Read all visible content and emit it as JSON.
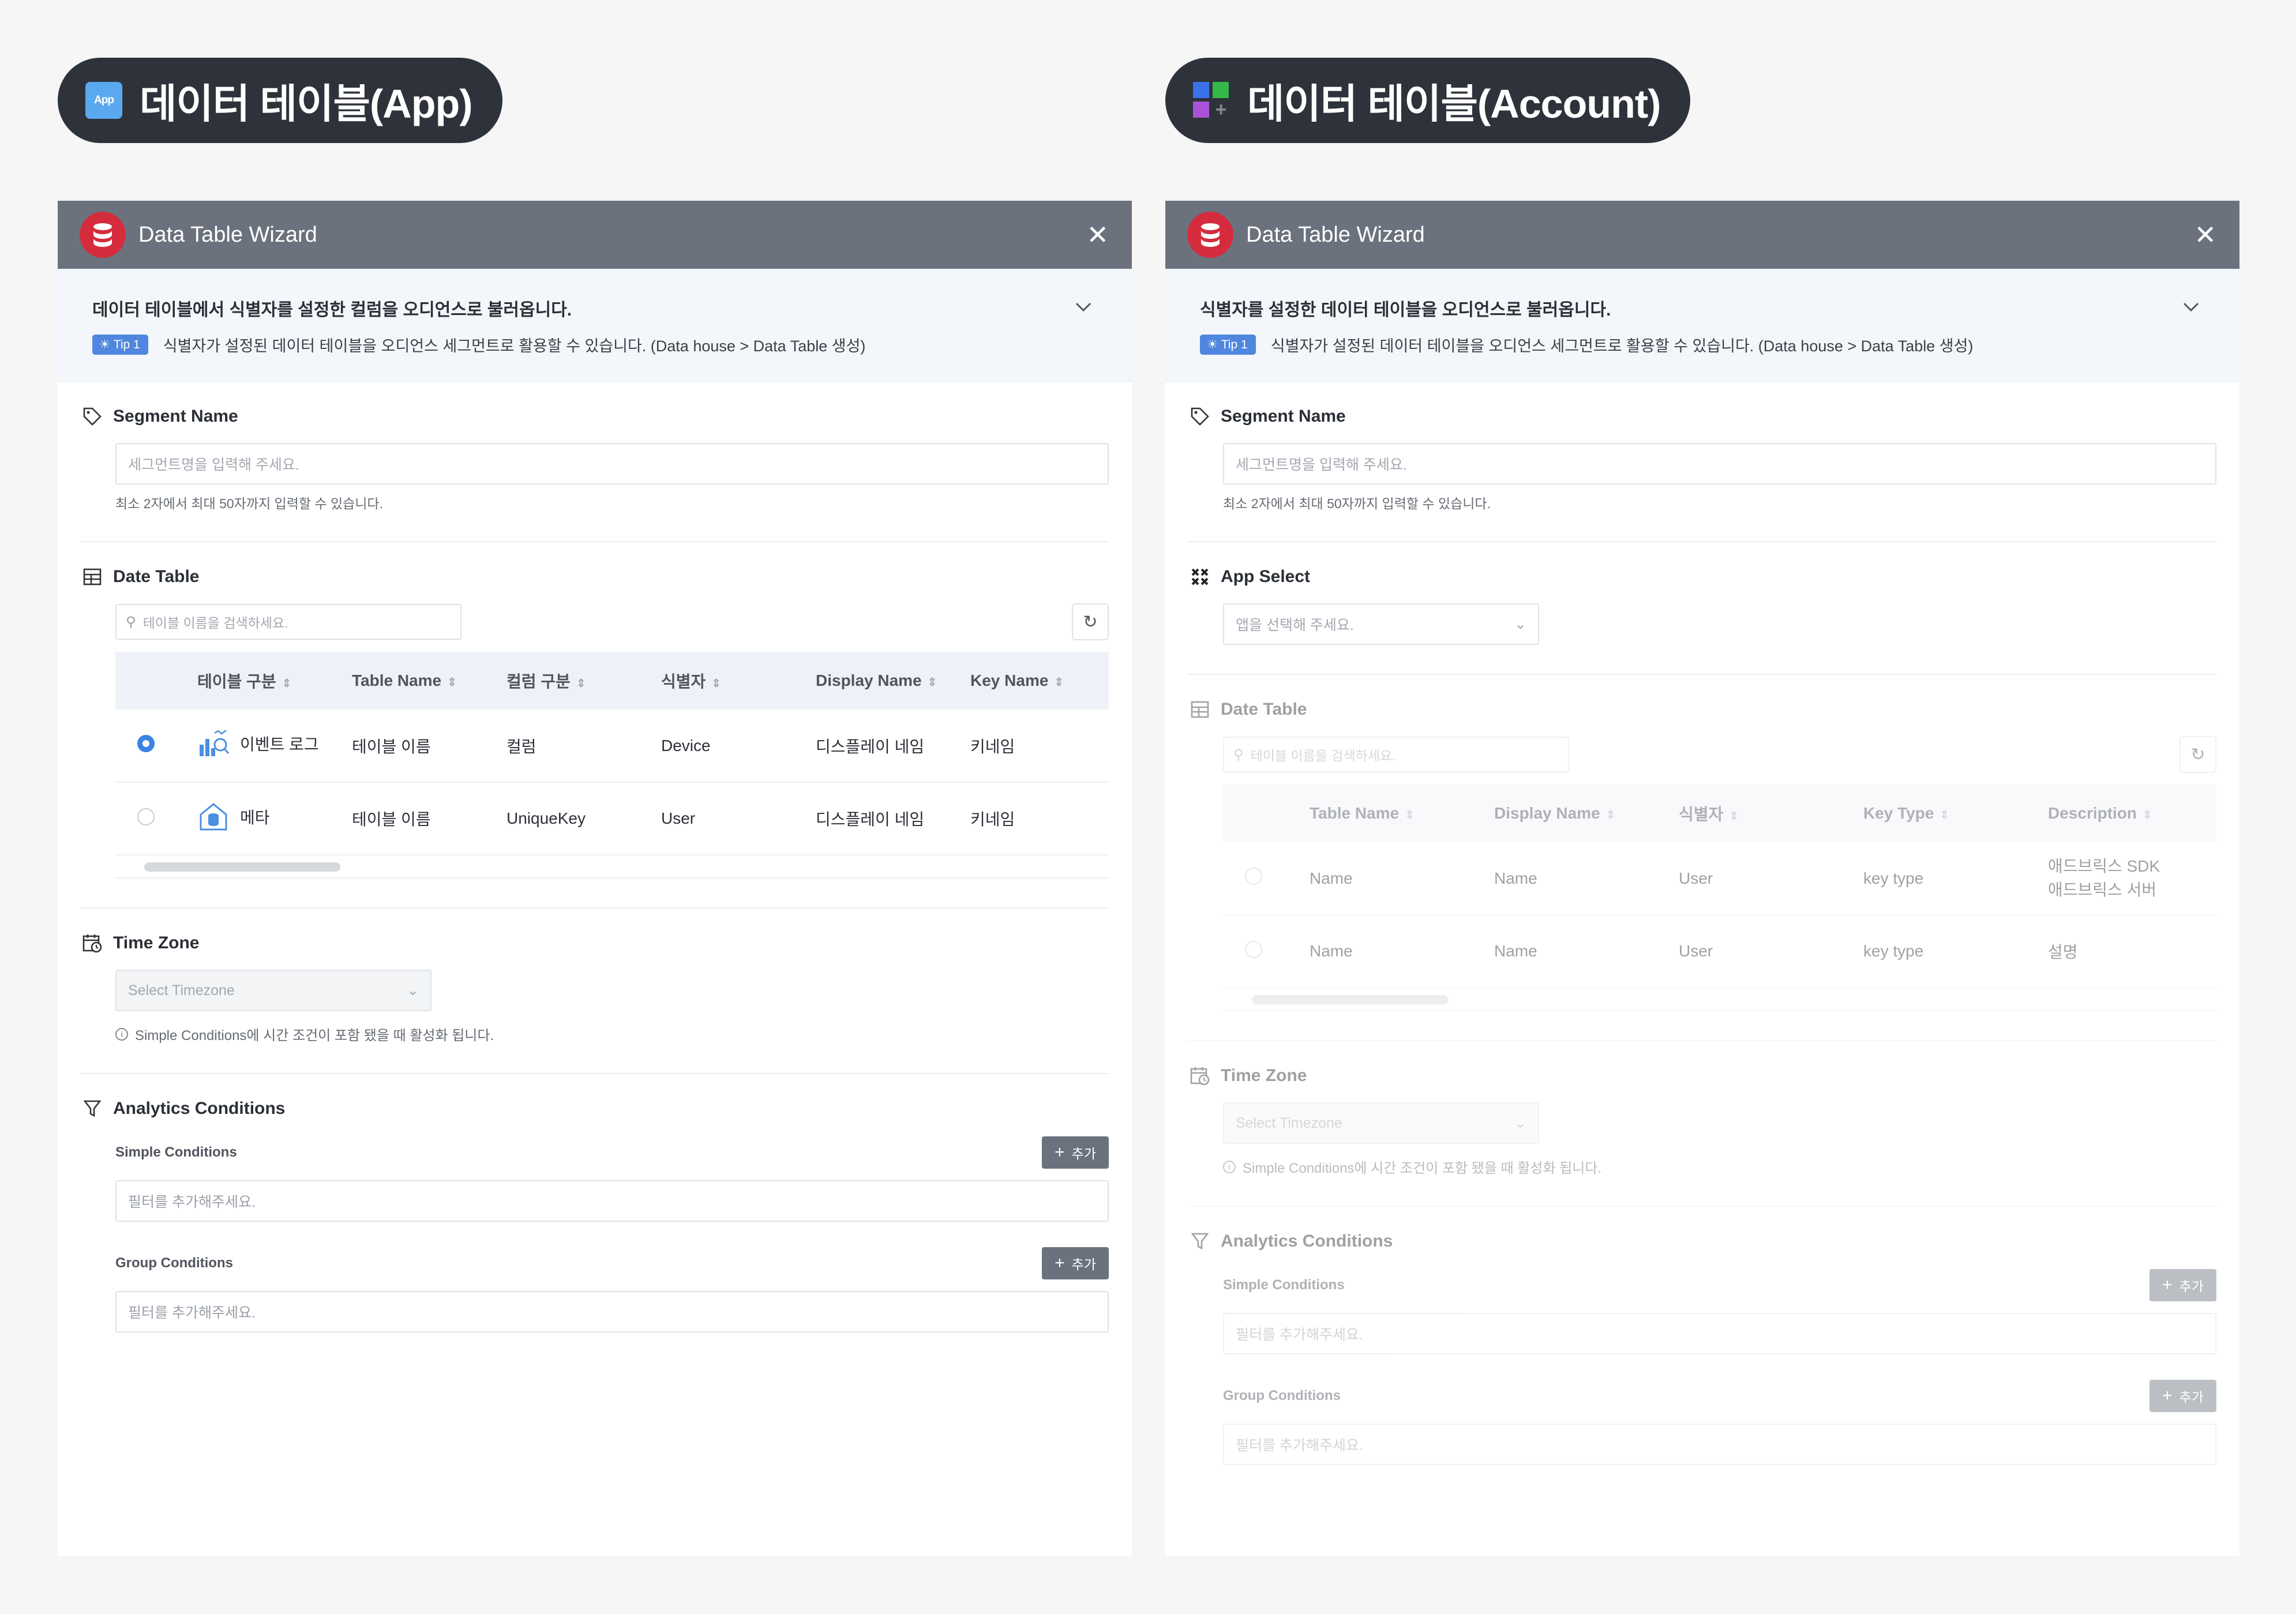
{
  "left": {
    "badge": {
      "logo_text": "App",
      "title": "데이터 테이블(App)"
    },
    "header": {
      "title": "Data Table Wizard",
      "close": "✕"
    },
    "info": {
      "title": "데이터 테이블에서 식별자를 설정한 컬럼을 오디언스로 불러옵니다.",
      "tip_label": "Tip 1",
      "tip_text": "식별자가 설정된 데이터 테이블을 오디언스 세그먼트로 활용할 수 있습니다. (Data house > Data Table 생성)"
    },
    "segment": {
      "label": "Segment Name",
      "placeholder": "세그먼트명을 입력해 주세요.",
      "hint": "최소 2자에서 최대 50자까지 입력할 수 있습니다."
    },
    "table": {
      "label": "Date Table",
      "search_placeholder": "테이블 이름을 검색하세요.",
      "columns": [
        "테이블 구분",
        "Table Name",
        "컬럼 구분",
        "식별자",
        "Display Name",
        "Key Name"
      ],
      "rows": [
        {
          "type": "이벤트 로그",
          "table_name": "테이블 이름",
          "column_type": "컬럼",
          "identifier": "Device",
          "display_name": "디스플레이 네임",
          "key_name": "키네임",
          "selected": true
        },
        {
          "type": "메타",
          "table_name": "테이블 이름",
          "column_type": "UniqueKey",
          "identifier": "User",
          "display_name": "디스플레이 네임",
          "key_name": "키네임",
          "selected": false
        }
      ]
    },
    "timezone": {
      "label": "Time Zone",
      "placeholder": "Select Timezone",
      "note": "Simple Conditions에 시간 조건이 포함 됐을 때 활성화 됩니다."
    },
    "analytics": {
      "label": "Analytics Conditions",
      "simple_label": "Simple Conditions",
      "group_label": "Group Conditions",
      "add_label": "추가",
      "filter_placeholder": "필터를 추가해주세요."
    }
  },
  "right": {
    "badge": {
      "title": "데이터 테이블(Account)"
    },
    "header": {
      "title": "Data Table Wizard",
      "close": "✕"
    },
    "info": {
      "title": "식별자를 설정한 데이터 테이블을 오디언스로 불러옵니다.",
      "tip_label": "Tip 1",
      "tip_text": "식별자가 설정된 데이터 테이블을 오디언스 세그먼트로 활용할 수 있습니다. (Data house > Data Table 생성)"
    },
    "segment": {
      "label": "Segment Name",
      "placeholder": "세그먼트명을 입력해 주세요.",
      "hint": "최소 2자에서 최대 50자까지 입력할 수 있습니다."
    },
    "app_select": {
      "label": "App Select",
      "placeholder": "앱을 선택해 주세요."
    },
    "table": {
      "label": "Date Table",
      "search_placeholder": "테이블 이름을 검색하세요.",
      "columns": [
        "Table Name",
        "Display Name",
        "식별자",
        "Key Type",
        "Description"
      ],
      "rows": [
        {
          "table_name": "Name",
          "display_name": "Name",
          "identifier": "User",
          "key_type": "key type",
          "description_1": "애드브릭스 SDK",
          "description_2": "애드브릭스 서버"
        },
        {
          "table_name": "Name",
          "display_name": "Name",
          "identifier": "User",
          "key_type": "key type",
          "description_1": "설명",
          "description_2": ""
        }
      ]
    },
    "timezone": {
      "label": "Time Zone",
      "placeholder": "Select Timezone",
      "note": "Simple Conditions에 시간 조건이 포함 됐을 때 활성화 됩니다."
    },
    "analytics": {
      "label": "Analytics Conditions",
      "simple_label": "Simple Conditions",
      "group_label": "Group Conditions",
      "add_label": "추가",
      "filter_placeholder": "필터를 추가해주세요."
    }
  },
  "colors": {
    "header_bg": "#6b727d",
    "badge_bg": "#2e333b",
    "accent": "#3a82e4",
    "db_icon": "#d42c3d"
  }
}
